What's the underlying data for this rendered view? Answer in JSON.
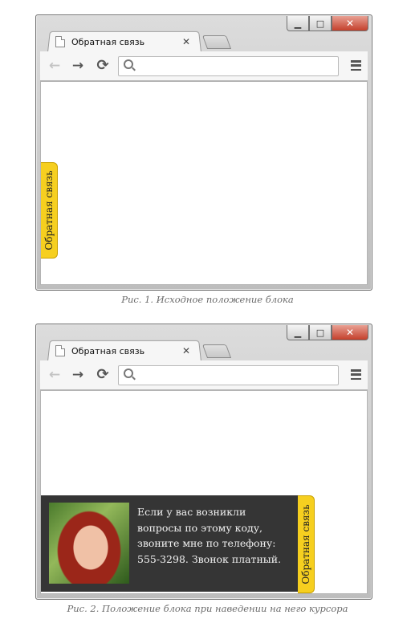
{
  "figures": [
    {
      "tab": {
        "title": "Обратная связь",
        "close": "✕"
      },
      "toolbar": {
        "back": "←",
        "forward": "→",
        "reload": "⟳"
      },
      "window_controls": {
        "min": "▁",
        "max": "□",
        "close": "✕"
      },
      "feedback_tab_label": "Обратная связь",
      "caption": "Рис. 1. Исходное положение блока"
    },
    {
      "tab": {
        "title": "Обратная связь",
        "close": "✕"
      },
      "toolbar": {
        "back": "←",
        "forward": "→",
        "reload": "⟳"
      },
      "window_controls": {
        "min": "▁",
        "max": "□",
        "close": "✕"
      },
      "feedback_tab_label": "Обратная связь",
      "panel_text": "Если у вас возникли вопросы по этому коду, звоните мне по телефону: 555-3298. Звонок платный.",
      "caption": "Рис. 2. Положение блока при наведении на него курсора"
    }
  ],
  "icons": {
    "page": "document-icon",
    "search": "search-icon",
    "menu": "hamburger-menu-icon"
  },
  "colors": {
    "feedback_tab": "#f6cf1f",
    "panel_bg": "#353535",
    "close_button": "#c4402c",
    "caption": "#6b6b6b"
  }
}
